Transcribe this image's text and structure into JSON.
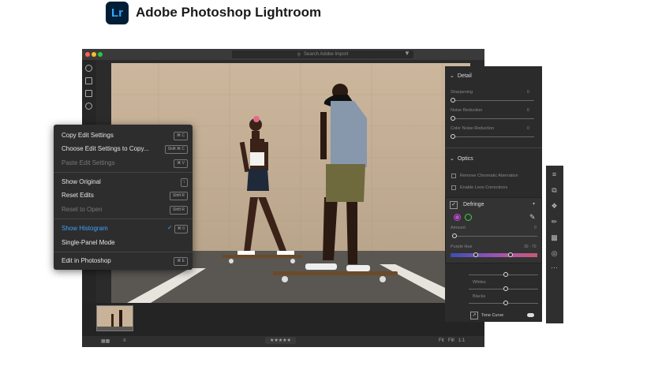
{
  "header": {
    "logo_text": "Lr",
    "title": "Adobe Photoshop Lightroom"
  },
  "search": {
    "placeholder": "Search Adobe Import"
  },
  "colors": {
    "accent": "#3ea2ff",
    "logo_bg": "#001e36",
    "logo_text": "#31a8ff",
    "close": "#ff5f57",
    "minimize": "#febc2e",
    "zoom": "#28c840"
  },
  "menu": {
    "items": [
      {
        "label": "Copy Edit Settings",
        "shortcut": "⌘ C",
        "enabled": true
      },
      {
        "label": "Choose Edit Settings to Copy...",
        "shortcut": "Shift ⌘ C",
        "enabled": true
      },
      {
        "label": "Paste Edit Settings",
        "shortcut": "⌘ V",
        "enabled": false
      },
      {
        "label": "Show Original",
        "shortcut": "\\",
        "enabled": true
      },
      {
        "label": "Reset Edits",
        "shortcut": "Shift R",
        "enabled": true
      },
      {
        "label": "Reset to Open",
        "shortcut": "Shift R",
        "enabled": false
      },
      {
        "label": "Show Histogram",
        "shortcut": "⌘ 0",
        "enabled": true,
        "checked": true
      },
      {
        "label": "Single-Panel Mode",
        "shortcut": "",
        "enabled": true
      },
      {
        "label": "Edit in Photoshop",
        "shortcut": "⌘ E",
        "enabled": true
      }
    ]
  },
  "panel": {
    "detail": {
      "title": "Detail",
      "sliders": [
        {
          "label": "Sharpening",
          "value": "0"
        },
        {
          "label": "Noise Reduction",
          "value": "0"
        },
        {
          "label": "Color Noise Reduction",
          "value": "0"
        }
      ]
    },
    "optics": {
      "title": "Optics",
      "checks": [
        "Remove Chromatic Aberration",
        "Enable Lens Corrections"
      ]
    },
    "defringe": {
      "title": "Defringe",
      "amount_label": "Amount",
      "amount_value": "0",
      "hue_label": "Purple Hue",
      "hue_value": "30 - 70"
    },
    "lower": {
      "sliders": [
        "Whites",
        "Blacks"
      ],
      "tone_curve": "Tone Curve"
    }
  },
  "icons": [
    "search-icon",
    "filter-icon",
    "checkmark-icon",
    "eyedropper-icon",
    "chevron-down-icon",
    "edit-sliders-icon",
    "crop-icon",
    "healing-icon",
    "brush-icon",
    "gradient-icon",
    "radial-icon",
    "more-icon",
    "star-icon",
    "grid-icon"
  ],
  "bottom": {
    "rating": "★★★★★",
    "fit": "Fit",
    "fill": "Fill",
    "ratio": "1:1"
  }
}
